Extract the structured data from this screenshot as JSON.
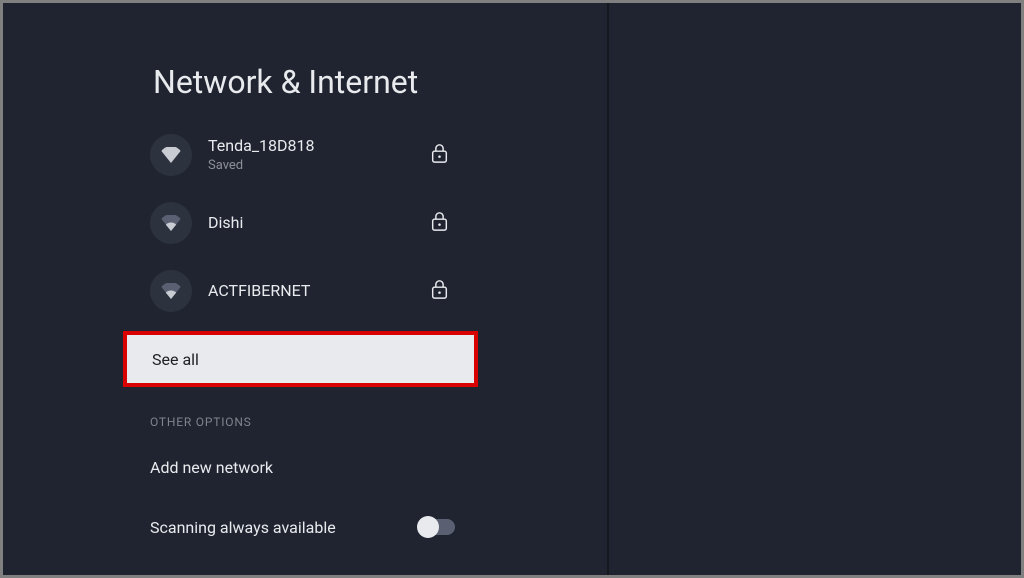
{
  "page": {
    "title": "Network & Internet"
  },
  "wifi": {
    "items": [
      {
        "name": "Tenda_18D818",
        "status": "Saved",
        "signal": "strong",
        "secured": true
      },
      {
        "name": "Dishi",
        "status": "",
        "signal": "medium",
        "secured": true
      },
      {
        "name": "ACTFIBERNET",
        "status": "",
        "signal": "medium",
        "secured": true
      }
    ],
    "see_all": "See all"
  },
  "sections": {
    "other_options": "OTHER OPTIONS"
  },
  "options": {
    "add_network": "Add new network",
    "scanning": {
      "label": "Scanning always available",
      "enabled": false
    }
  }
}
